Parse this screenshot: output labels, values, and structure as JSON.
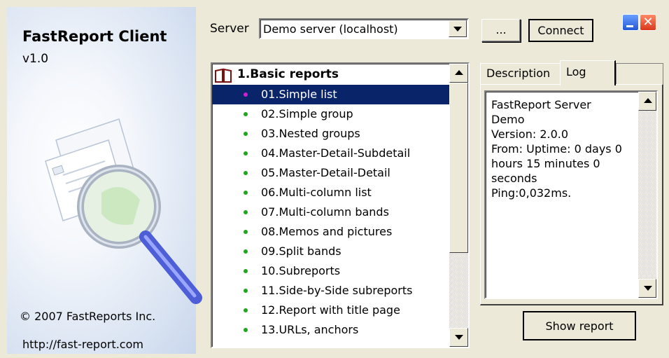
{
  "app": {
    "title": "FastReport Client",
    "version": "v1.0",
    "copyright": "© 2007 FastReports Inc.",
    "website": "http://fast-report.com"
  },
  "server": {
    "label": "Server",
    "selected": "Demo server (localhost)",
    "browse_label": "...",
    "connect_label": "Connect"
  },
  "report_tree": {
    "group_label": "1.Basic reports",
    "items": [
      "01.Simple list",
      "02.Simple group",
      "03.Nested groups",
      "04.Master-Detail-Subdetail",
      "05.Master-Detail-Detail",
      "06.Multi-column list",
      "07.Multi-column bands",
      "08.Memos and pictures",
      "09.Split bands",
      "10.Subreports",
      "11.Side-by-Side subreports",
      "12.Report with title page",
      "13.URLs, anchors"
    ],
    "selected_index": 0
  },
  "tabs": {
    "description": "Description",
    "log": "Log",
    "active": "log"
  },
  "log": {
    "text": "FastReport Server\nDemo\nVersion: 2.0.0\nFrom: Uptime: 0 days 0\nhours 15 minutes 0\nseconds\nPing:0,032ms."
  },
  "actions": {
    "show_report_label": "Show report"
  },
  "colors": {
    "selection": "#0a246a",
    "item_dot": "#1fa51f",
    "selected_dot": "#d01fd0"
  }
}
